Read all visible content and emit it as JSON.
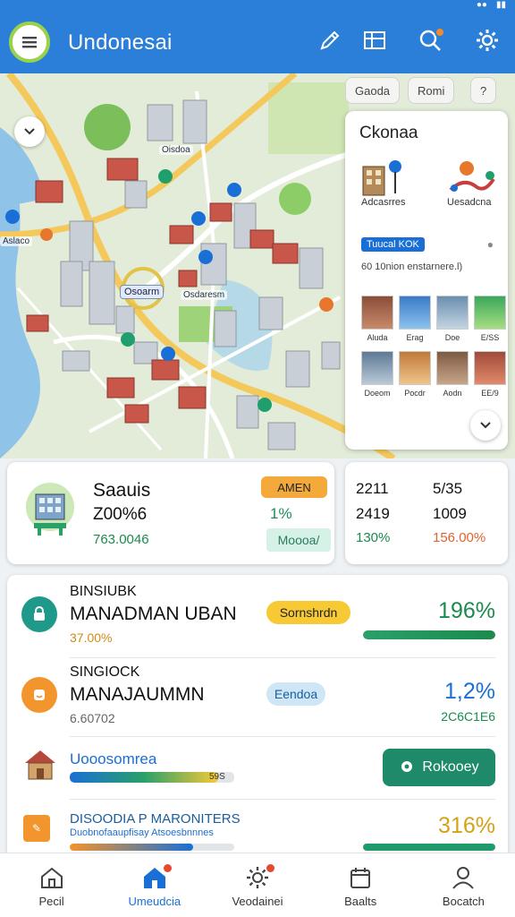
{
  "header": {
    "title": "Undonesai"
  },
  "map": {
    "chips": [
      "Gaoda",
      "Romi",
      "?"
    ],
    "labels": [
      "Oisdoa",
      "Aslaco",
      "Osdaresm"
    ],
    "center_label": "Osoarm"
  },
  "side_panel": {
    "title": "Ckonaa",
    "categories": [
      {
        "label": "Adcasrres",
        "icon": "building-pin-icon"
      },
      {
        "label": "Uesadcna",
        "icon": "route-pin-icon"
      }
    ],
    "tag": "Tuucal KOK",
    "subtitle": "60 10nion enstarnere.l)",
    "thumbs_row1": [
      "Aluda",
      "Erag",
      "Doe",
      "E/SS"
    ],
    "thumbs_row2": [
      "Doeom",
      "Pocdr",
      "Aodn",
      "EE/9"
    ]
  },
  "summary": {
    "title": "Saauis",
    "value": "Z00%6",
    "sub": "763.0046",
    "pill": "AMEN",
    "pct": "1%",
    "pill2": "Moooa/"
  },
  "stats": {
    "col1": [
      "2211",
      "2419",
      "130%"
    ],
    "col2": [
      "5/35",
      "1009",
      "156.00%"
    ]
  },
  "list": [
    {
      "kicker": "BINSIUBK",
      "title": "MANADMAN UBAN",
      "sub": "37.00%",
      "pill": "Sornshrdn",
      "pct": "196%",
      "progress": 1.0
    },
    {
      "kicker": "SINGIOCK",
      "title": "MANAJAUMMN",
      "sub": "6.60702",
      "pill": "Eendoa",
      "pct": "1,2%",
      "right_sub": "2C6C1E6"
    },
    {
      "title": "Uooosomrea",
      "bar_value": "59S",
      "progress": 0.9,
      "button": "Rokooey"
    },
    {
      "title": "DISOODIA P MARONITERS",
      "sub": "Duobnofaaupfisay Atsoesbnnnes",
      "pct": "316%",
      "progress": 0.75
    }
  ],
  "nav": [
    {
      "label": "Pecil",
      "icon": "home-icon"
    },
    {
      "label": "Umeudcia",
      "icon": "house-icon"
    },
    {
      "label": "Veodainei",
      "icon": "gear-icon"
    },
    {
      "label": "Baalts",
      "icon": "calendar-icon"
    },
    {
      "label": "Bocatch",
      "icon": "user-icon"
    }
  ],
  "colors": {
    "app_bar": "#2b7fd9",
    "accent_green": "#1b8a4d",
    "pill_orange": "#f4a93b",
    "pill_yellow": "#f6c935",
    "button_teal": "#1e8a6a",
    "nav_active": "#1a6fd6"
  }
}
